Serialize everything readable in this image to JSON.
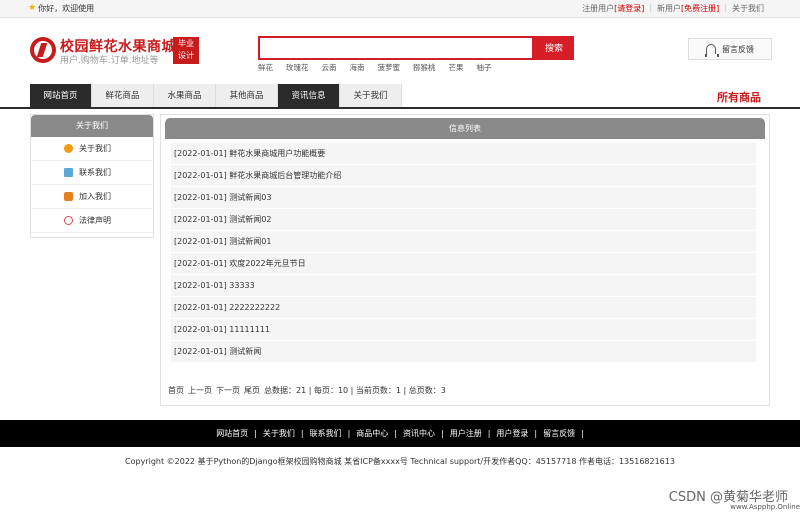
{
  "topbar": {
    "welcome": "你好，欢迎使用",
    "reg_user": "注册用户",
    "login_link": "[请登录]",
    "new_user": "新用户",
    "free_reg": "[免费注册]",
    "about": "关于我们"
  },
  "header": {
    "title": "校园鲜花水果商城",
    "subtitle": "用户.购物车.订单.地址等",
    "badge_line1": "毕业",
    "badge_line2": "设计",
    "search_button": "搜索",
    "search_placeholder": "",
    "hotwords": [
      "鲜花",
      "玫瑰花",
      "云南",
      "海南",
      "菠萝蜜",
      "猕猴桃",
      "芒果",
      "柚子"
    ],
    "feedback": "留言反馈"
  },
  "nav": {
    "tabs": [
      "网站首页",
      "鲜花商品",
      "水果商品",
      "其他商品",
      "资讯信息",
      "关于我们"
    ],
    "all_goods": "所有商品"
  },
  "sidebar": {
    "title": "关于我们",
    "items": [
      "关于我们",
      "联系我们",
      "加入我们",
      "法律声明"
    ]
  },
  "main": {
    "title": "信息列表",
    "news": [
      "[2022-01-01] 鲜花水果商城用户功能概要",
      "[2022-01-01] 鲜花水果商城后台管理功能介绍",
      "[2022-01-01] 测试新闻03",
      "[2022-01-01] 测试新闻02",
      "[2022-01-01] 测试新闻01",
      "[2022-01-01] 欢度2022年元旦节日",
      "[2022-01-01] 33333",
      "[2022-01-01] 2222222222",
      "[2022-01-01] 11111111",
      "[2022-01-01] 测试新闻"
    ],
    "pager": {
      "first": "首页",
      "prev": "上一页",
      "next": "下一页",
      "last": "尾页",
      "stats": "总数据：21 | 每页：10 | 当前页数：1 | 总页数：3"
    }
  },
  "footer": {
    "links": [
      "网站首页",
      "关于我们",
      "联系我们",
      "商品中心",
      "资讯中心",
      "用户注册",
      "用户登录",
      "留言反馈"
    ],
    "copyright": "Copyright ©2022 基于Python的Django框架校园购物商城 某省ICP备xxxx号    Technical support/开发作者QQ：45157718     作者电话：13516821613",
    "watermark": "CSDN @黄菊华老师",
    "watermark2": "www.Aspphp.Online"
  },
  "colors": {
    "brand": "#c81c1c",
    "nav_dark": "#2b2b2b",
    "panel_head": "#8a8a8a"
  }
}
